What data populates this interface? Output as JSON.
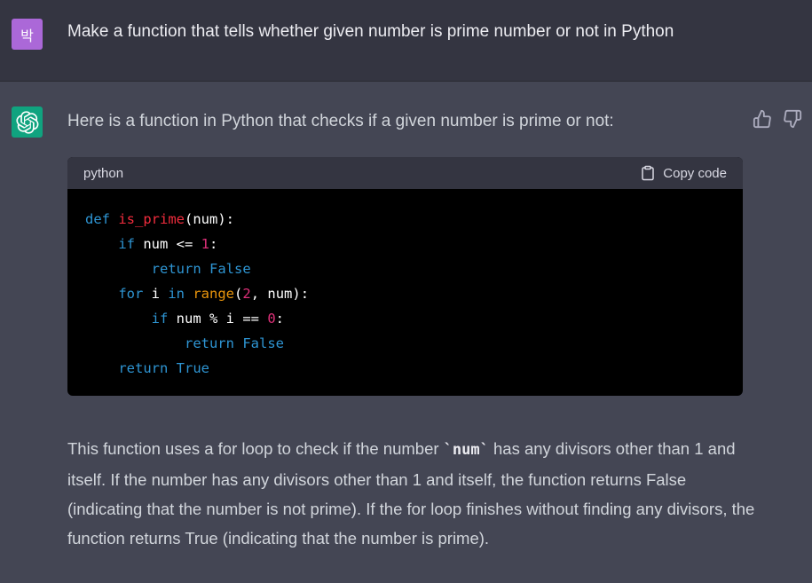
{
  "user_message": {
    "avatar_text": "박",
    "avatar_color": "#ab68d8",
    "text": "Make a function that tells whether given number is prime number or not in Python"
  },
  "assistant_message": {
    "avatar_color": "#10a37f",
    "avatar_icon": "openai-logo-icon",
    "intro": "Here is a function in Python that checks if a given number is prime or not:",
    "code_block": {
      "language": "python",
      "copy_label": "Copy code",
      "lines": [
        [
          {
            "t": "def",
            "c": "kw"
          },
          {
            "t": " ",
            "c": "txt"
          },
          {
            "t": "is_prime",
            "c": "fn"
          },
          {
            "t": "(num):",
            "c": "txt"
          }
        ],
        [
          {
            "t": "    ",
            "c": "txt"
          },
          {
            "t": "if",
            "c": "kw"
          },
          {
            "t": " num <= ",
            "c": "txt"
          },
          {
            "t": "1",
            "c": "num"
          },
          {
            "t": ":",
            "c": "txt"
          }
        ],
        [
          {
            "t": "        ",
            "c": "txt"
          },
          {
            "t": "return",
            "c": "kw"
          },
          {
            "t": " ",
            "c": "txt"
          },
          {
            "t": "False",
            "c": "kw"
          }
        ],
        [
          {
            "t": "    ",
            "c": "txt"
          },
          {
            "t": "for",
            "c": "kw"
          },
          {
            "t": " i ",
            "c": "txt"
          },
          {
            "t": "in",
            "c": "kw"
          },
          {
            "t": " ",
            "c": "txt"
          },
          {
            "t": "range",
            "c": "bi"
          },
          {
            "t": "(",
            "c": "txt"
          },
          {
            "t": "2",
            "c": "num"
          },
          {
            "t": ", num):",
            "c": "txt"
          }
        ],
        [
          {
            "t": "        ",
            "c": "txt"
          },
          {
            "t": "if",
            "c": "kw"
          },
          {
            "t": " num % i == ",
            "c": "txt"
          },
          {
            "t": "0",
            "c": "num"
          },
          {
            "t": ":",
            "c": "txt"
          }
        ],
        [
          {
            "t": "            ",
            "c": "txt"
          },
          {
            "t": "return",
            "c": "kw"
          },
          {
            "t": " ",
            "c": "txt"
          },
          {
            "t": "False",
            "c": "kw"
          }
        ],
        [
          {
            "t": "    ",
            "c": "txt"
          },
          {
            "t": "return",
            "c": "kw"
          },
          {
            "t": " ",
            "c": "txt"
          },
          {
            "t": "True",
            "c": "kw"
          }
        ]
      ]
    },
    "explanation_before": "This function uses a for loop to check if the number ",
    "explanation_code": "`num`",
    "explanation_after": " has any divisors other than 1 and itself. If the number has any divisors other than 1 and itself, the function returns False (indicating that the number is not prime). If the for loop finishes without finding any divisors, the function returns True (indicating that the number is prime).",
    "feedback": {
      "thumbs_up_icon": "thumbs-up-icon",
      "thumbs_down_icon": "thumbs-down-icon"
    }
  },
  "colors": {
    "user_bg": "#343541",
    "assistant_bg": "#444654",
    "code_bg": "#000000",
    "code_header_bg": "#343541",
    "keyword": "#2e95d3",
    "function_name": "#f22c3d",
    "number": "#df3079",
    "builtin": "#e9950c"
  }
}
